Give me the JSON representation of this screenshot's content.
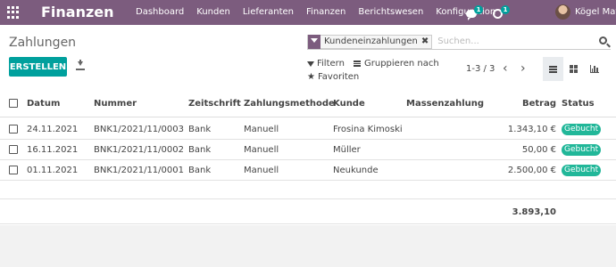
{
  "app": {
    "title": "Finanzen",
    "menu": [
      "Dashboard",
      "Kunden",
      "Lieferanten",
      "Finanzen",
      "Berichtswesen",
      "Konfiguration"
    ],
    "messages_count": "1",
    "activities_count": "1",
    "user_name": "Kögel Matthias",
    "brand_color": "#7c5c7e"
  },
  "control": {
    "breadcrumb": "Zahlungen",
    "facet_label": "Kundeneinzahlungen",
    "search_placeholder": "Suchen...",
    "create_label": "ERSTELLEN",
    "filter_label": "Filtern",
    "group_label": "Gruppieren nach",
    "favorites_label": "Favoriten",
    "pager": "1-3 / 3",
    "accent_color": "#00a09d"
  },
  "table": {
    "headers": {
      "date": "Datum",
      "number": "Nummer",
      "journal": "Zeitschrift",
      "method": "Zahlungsmethode",
      "customer": "Kunde",
      "batch": "Massenzahlung",
      "amount": "Betrag",
      "status": "Status"
    },
    "rows": [
      {
        "date": "24.11.2021",
        "number": "BNK1/2021/11/0003",
        "journal": "Bank",
        "method": "Manuell",
        "customer": "Frosina Kimoski",
        "batch": "",
        "amount": "1.343,10 €",
        "status": "Gebucht"
      },
      {
        "date": "16.11.2021",
        "number": "BNK1/2021/11/0002",
        "journal": "Bank",
        "method": "Manuell",
        "customer": "Müller",
        "batch": "",
        "amount": "50,00 €",
        "status": "Gebucht"
      },
      {
        "date": "01.11.2021",
        "number": "BNK1/2021/11/0001",
        "journal": "Bank",
        "method": "Manuell",
        "customer": "Neukunde",
        "batch": "",
        "amount": "2.500,00 €",
        "status": "Gebucht"
      }
    ],
    "total": "3.893,10",
    "status_color": "#21b799"
  }
}
